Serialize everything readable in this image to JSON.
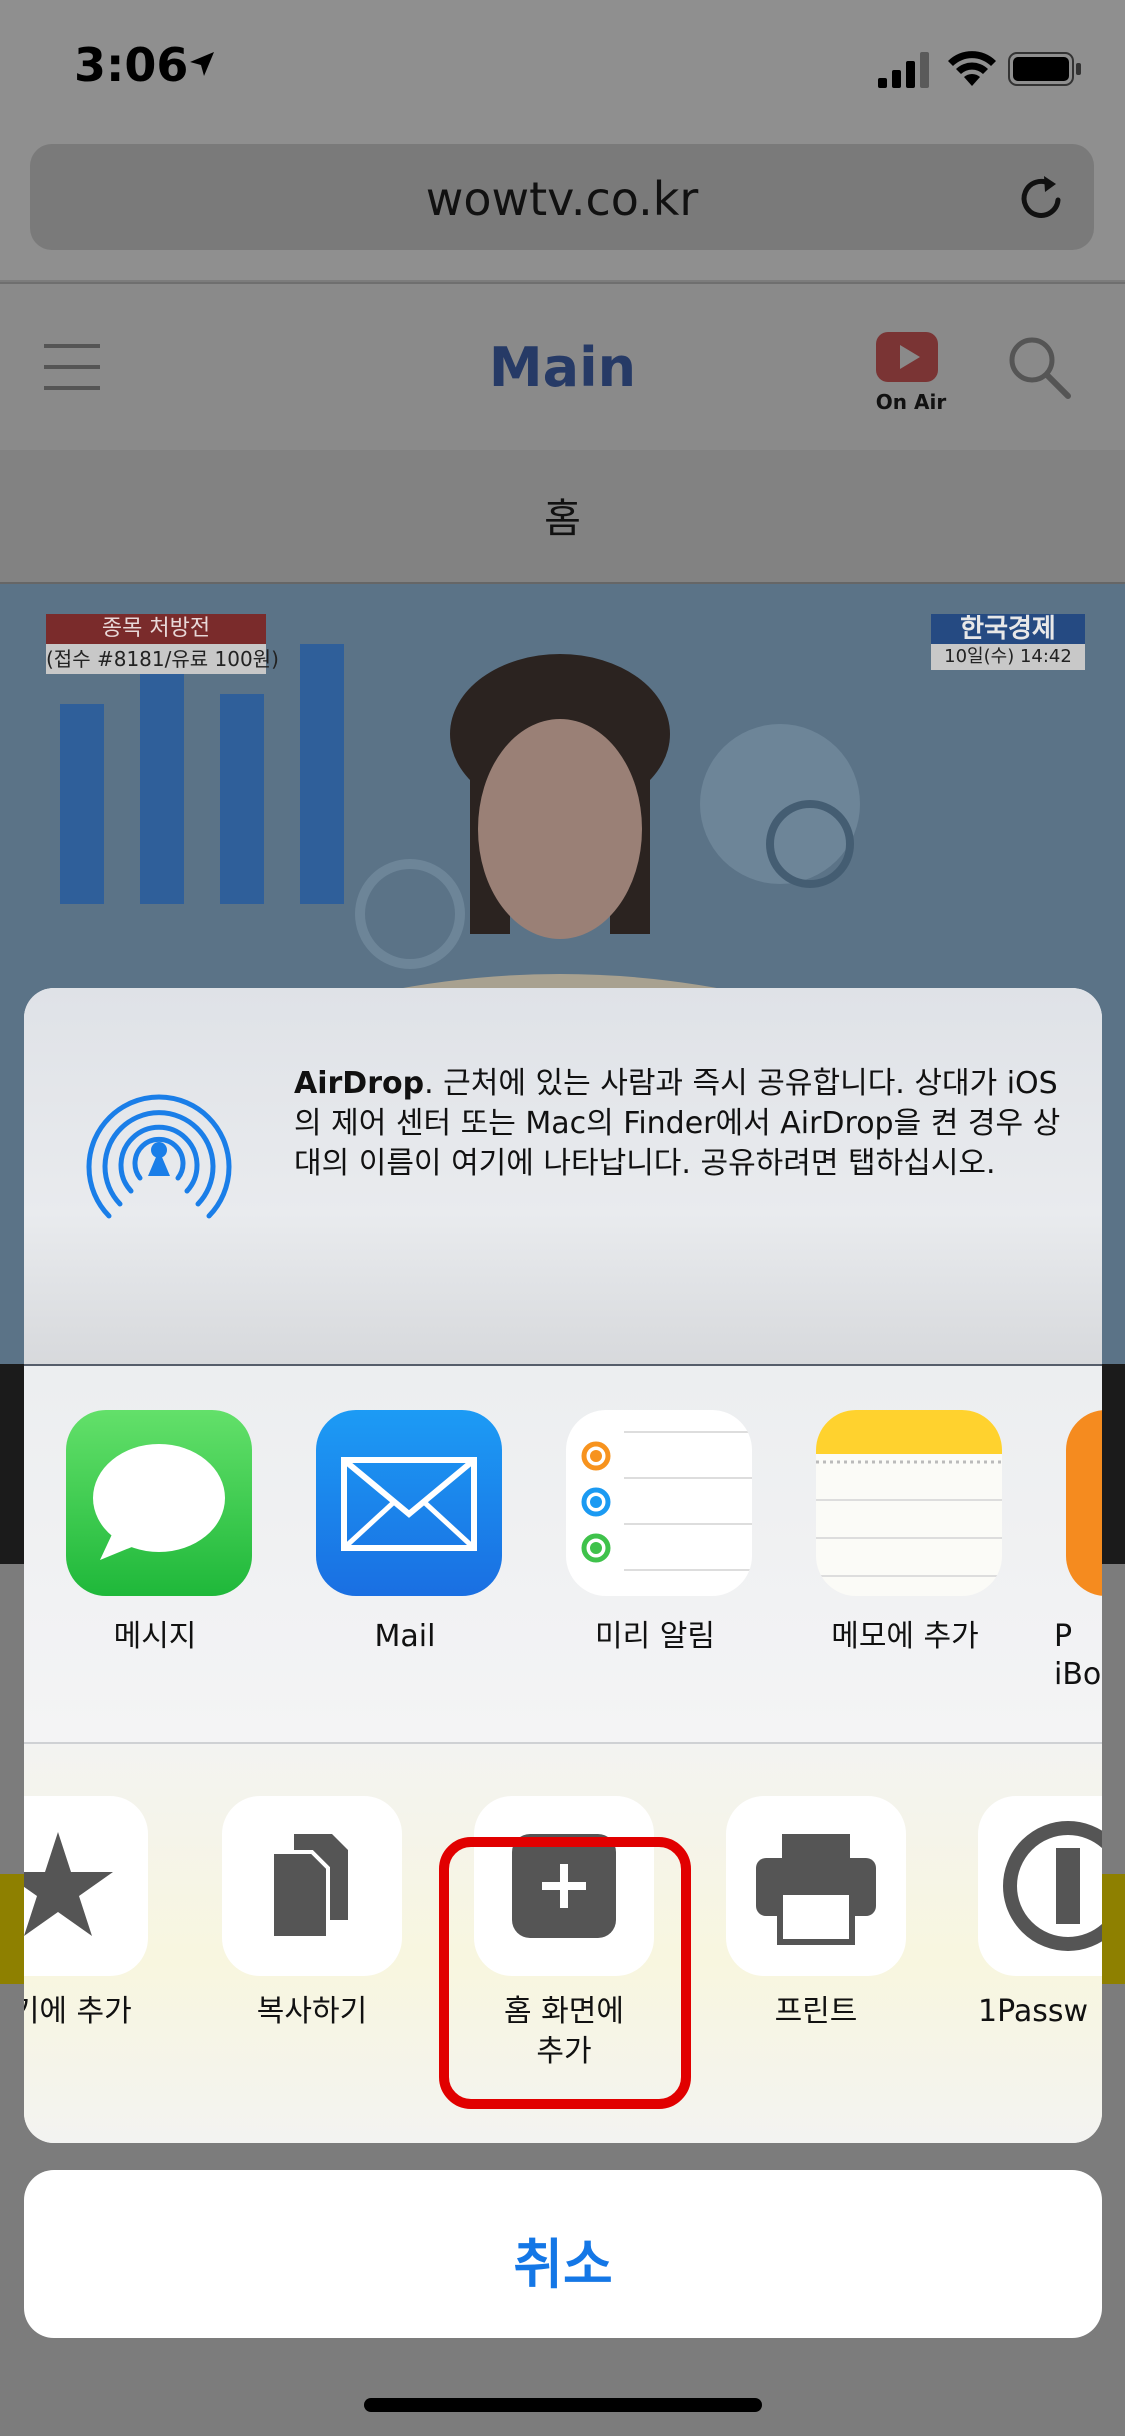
{
  "status_bar": {
    "time": "3:06"
  },
  "browser": {
    "url": "wowtv.co.kr"
  },
  "site": {
    "title": "Main",
    "on_air_label": "On Air",
    "subnav_label": "홈"
  },
  "video": {
    "ticker_title": "종목 처방전",
    "ticker_sub": "(접수 #8181/유료 100원)",
    "channel_name": "한국경제",
    "channel_time": "10일(수) 14:42"
  },
  "share_sheet": {
    "airdrop": {
      "title": "AirDrop",
      "description": ". 근처에 있는 사람과 즉시 공유합니다. 상대가 iOS의 제어 센터 또는 Mac의 Finder에서 AirDrop을 켠 경우 상대의 이름이 여기에 나타납니다. 공유하려면 탭하십시오."
    },
    "apps": [
      {
        "label": "메시지",
        "icon": "messages-icon"
      },
      {
        "label": "Mail",
        "icon": "mail-icon"
      },
      {
        "label": "미리 알림",
        "icon": "reminders-icon"
      },
      {
        "label": "메모에 추가",
        "icon": "notes-icon"
      },
      {
        "label": "P\niBo",
        "icon": "ibooks-icon"
      }
    ],
    "actions": [
      {
        "label": "찾기에 추가",
        "icon": "star-icon"
      },
      {
        "label": "복사하기",
        "icon": "copy-icon"
      },
      {
        "label": "홈 화면에\n추가",
        "icon": "add-home-icon"
      },
      {
        "label": "프린트",
        "icon": "print-icon"
      },
      {
        "label": "1Passw",
        "icon": "onepassword-icon"
      }
    ],
    "cancel_label": "취소"
  },
  "colors": {
    "accent": "#1477e6",
    "highlight": "#e10000",
    "airdrop": "#1a7ee8",
    "messages": "#2fc74a",
    "notes": "#ffd22e"
  }
}
